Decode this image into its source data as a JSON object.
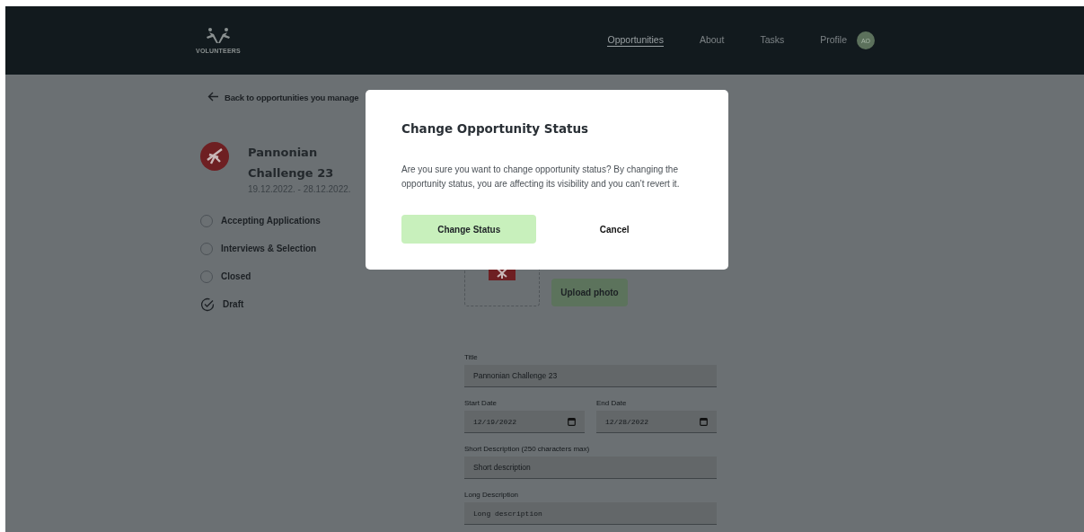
{
  "header": {
    "logo_text": "VOLUNTEERS",
    "nav": [
      {
        "label": "Opportunities",
        "selected": true
      },
      {
        "label": "About",
        "selected": false
      },
      {
        "label": "Tasks",
        "selected": false
      },
      {
        "label": "Profile",
        "selected": false
      }
    ],
    "avatar": "AO"
  },
  "back_link": "Back to opportunities you manage",
  "opportunity": {
    "title": "Pannonian Challenge 23",
    "dates": "19.12.2022. - 28.12.2022."
  },
  "statuses": [
    {
      "label": "Accepting Applications",
      "selected": false
    },
    {
      "label": "Interviews & Selection",
      "selected": false
    },
    {
      "label": "Closed",
      "selected": false
    },
    {
      "label": "Draft",
      "selected": true
    }
  ],
  "upload_button": "Upload photo",
  "form": [
    {
      "kind": "text",
      "label": "Title",
      "value": "Pannonian Challenge 23"
    },
    {
      "kind": "dates",
      "fields": [
        {
          "label": "Start Date",
          "value": "12/19/2022"
        },
        {
          "label": "End Date",
          "value": "12/28/2022"
        }
      ]
    },
    {
      "kind": "text",
      "label": "Short Description (250 characters max)",
      "value": "Short description"
    },
    {
      "kind": "mono",
      "label": "Long Description",
      "value": "Long description"
    }
  ],
  "dialog": {
    "title": "Change Opportunity Status",
    "message": "Are you sure you want to change opportunity status? By changing the opportunity status, you are affecting its visibility and you can’t revert it.",
    "confirm": "Change Status",
    "cancel": "Cancel"
  }
}
